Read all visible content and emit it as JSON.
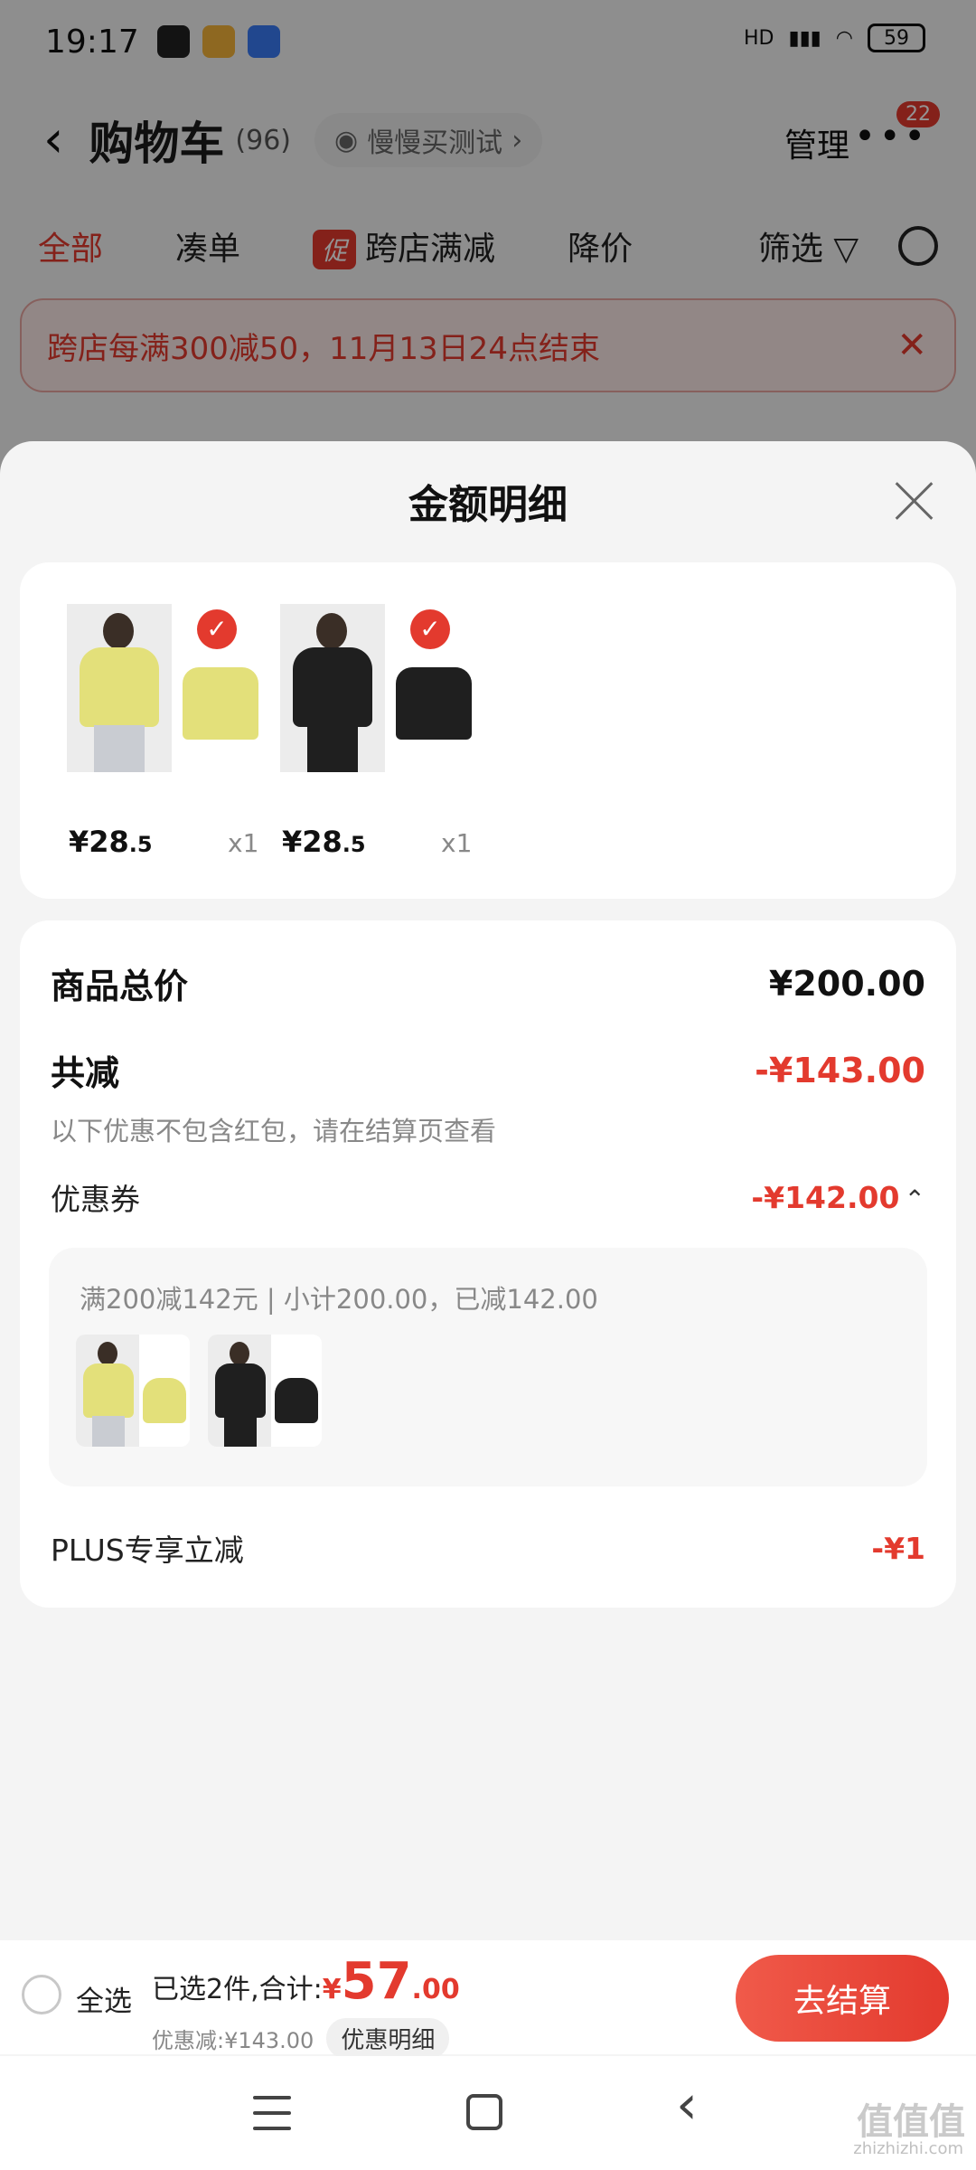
{
  "status_bar": {
    "time": "19:17",
    "network": "HD",
    "battery": "59"
  },
  "nav": {
    "back": "‹",
    "title": "购物车",
    "count": "(96)",
    "slow_buy": "慢慢买测试",
    "manage": "管理",
    "more": "•••",
    "badge": "22"
  },
  "tabs": [
    {
      "label": "全部"
    },
    {
      "label": "凑单"
    },
    {
      "chip": "促",
      "label": "跨店满减"
    },
    {
      "label": "降价"
    },
    {
      "label": "筛选"
    }
  ],
  "banner": {
    "text": "跨店每满300减50，11月13日24点结束",
    "close": "✕"
  },
  "sheet": {
    "title": "金额明细",
    "products": [
      {
        "price": "¥28",
        "price_dec": ".5",
        "qty": "x1",
        "color": "#e3e07a"
      },
      {
        "price": "¥28",
        "price_dec": ".5",
        "qty": "x1",
        "color": "#1f1f1f"
      }
    ],
    "summary": {
      "total_label": "商品总价",
      "total_value": "¥200.00",
      "reduce_label": "共减",
      "reduce_value": "-¥143.00",
      "note": "以下优惠不包含红包，请在结算页查看",
      "coupon_label": "优惠券",
      "coupon_value": "-¥142.00",
      "coupon_detail": "满200减142元 | 小计200.00，已减142.00",
      "plus_label": "PLUS专享立减",
      "plus_value": "-¥1"
    }
  },
  "bottom_bar": {
    "select_all": "全选",
    "selected_text": "已选2件,合计:",
    "currency": "¥",
    "total_int": "57",
    "total_dec": ".00",
    "discount": "优惠减:¥143.00",
    "detail_chip": "优惠明细",
    "checkout": "去结算"
  },
  "watermark": {
    "main": "值值值",
    "sub": "zhizhizhi.com"
  },
  "colors": {
    "accent": "#e33a2e",
    "background": "#f4f4f4",
    "card": "#ffffff"
  }
}
